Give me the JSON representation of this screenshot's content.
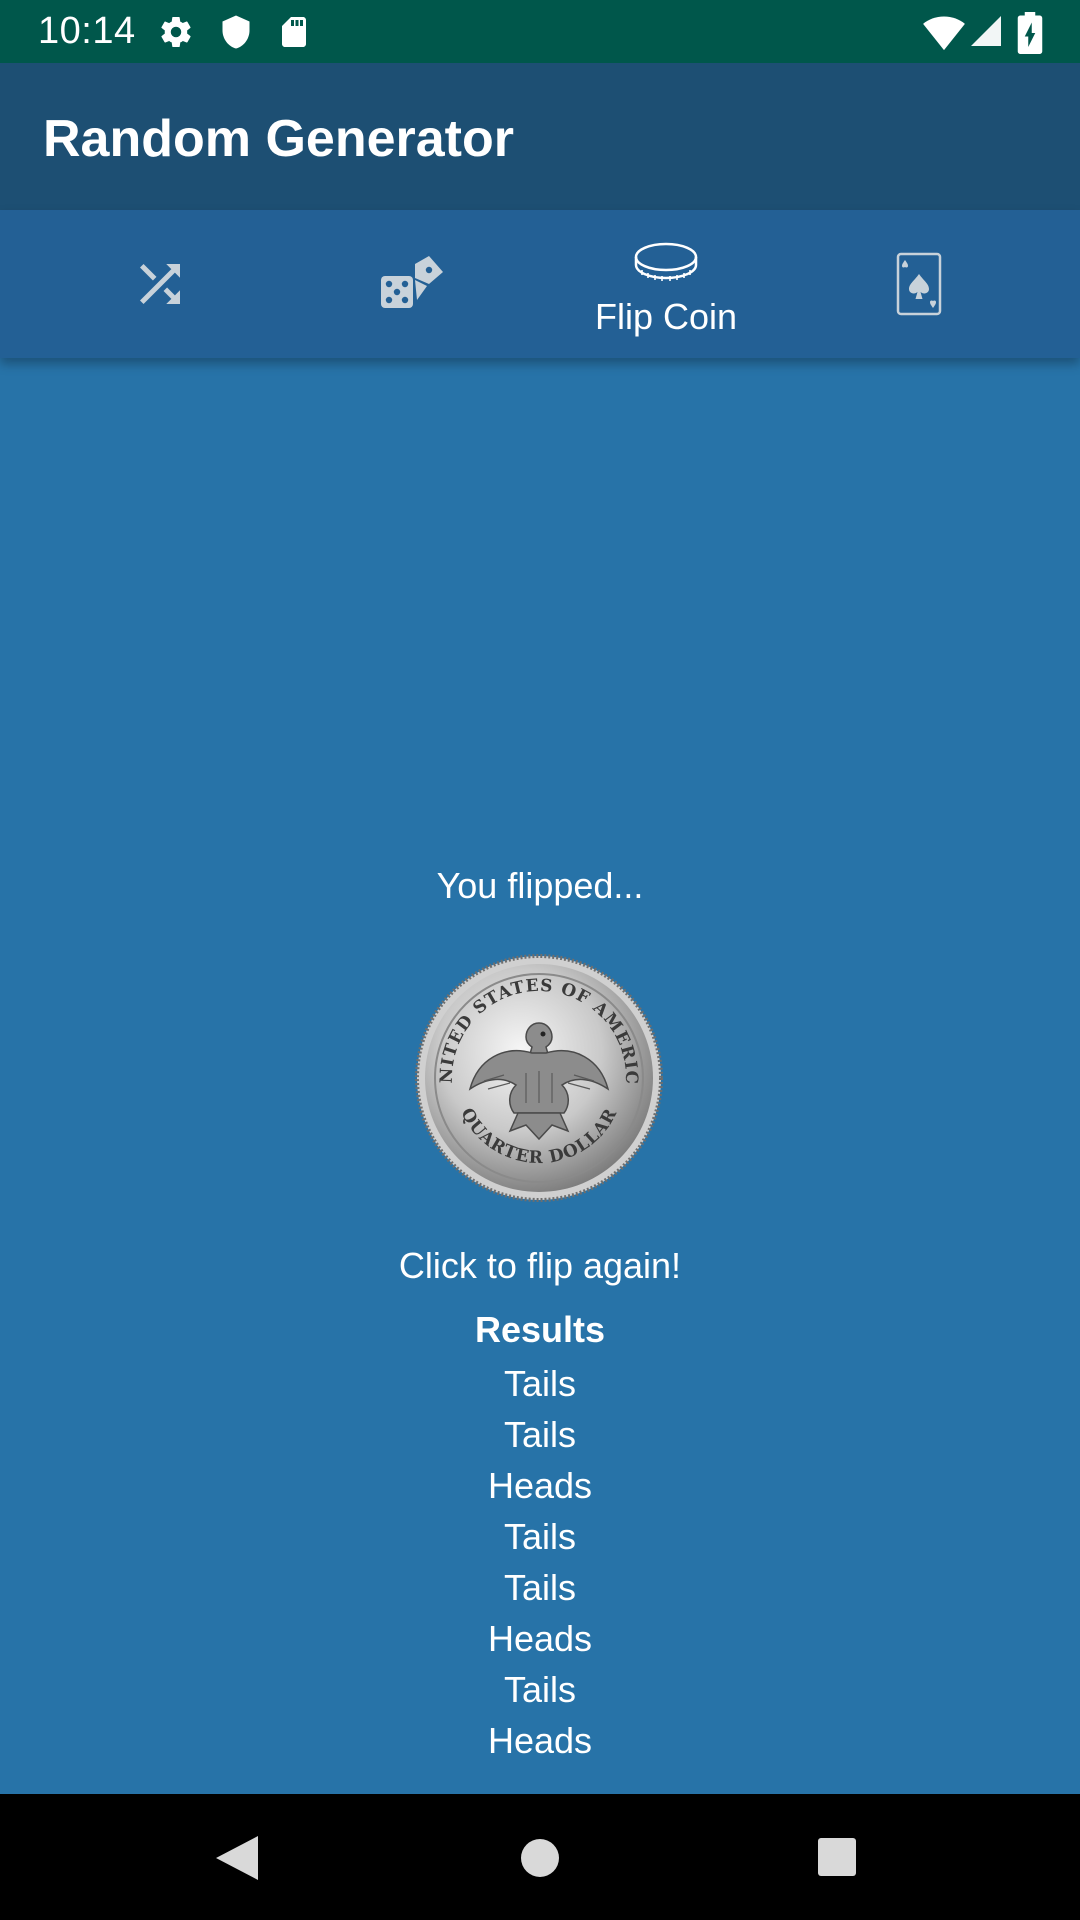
{
  "status_bar": {
    "time": "10:14",
    "icons": [
      "gear-icon",
      "shield-icon",
      "sd-card-icon",
      "wifi-icon",
      "signal-icon",
      "battery-charging-icon"
    ],
    "background": "#00574b"
  },
  "app_bar": {
    "title": "Random Generator",
    "background": "#1d4f73"
  },
  "tabs": [
    {
      "icon": "shuffle-icon",
      "label": "",
      "selected": false
    },
    {
      "icon": "dice-icon",
      "label": "",
      "selected": false
    },
    {
      "icon": "coin-icon",
      "label": "Flip Coin",
      "selected": true
    },
    {
      "icon": "playing-card-icon",
      "label": "",
      "selected": false
    }
  ],
  "content": {
    "prompt": "You flipped...",
    "coin_image": "quarter-eagle-coin",
    "coin_inscriptions": [
      "UNITED STATES OF AMERICA",
      "QUARTER DOLLAR"
    ],
    "flip_again": "Click to flip again!",
    "results_title": "Results",
    "results": [
      "Tails",
      "Tails",
      "Heads",
      "Tails",
      "Tails",
      "Heads",
      "Tails",
      "Heads"
    ],
    "background": "#2773a8"
  },
  "nav_bar": {
    "buttons": [
      "back-icon",
      "home-icon",
      "recents-icon"
    ]
  },
  "colors": {
    "tab_bar": "#236095",
    "icon_inactive": "#c8d2da",
    "text": "#ffffff"
  }
}
